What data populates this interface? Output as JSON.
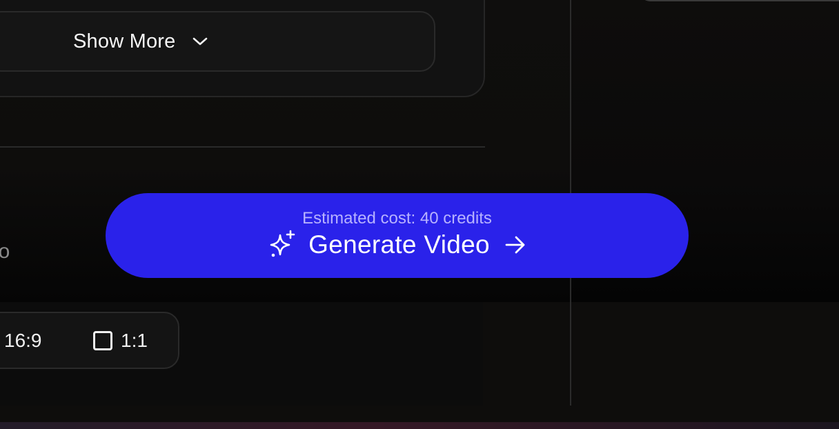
{
  "settings": {
    "show_more_label": "Show More",
    "aspect_ratio_label": "atio",
    "aspect_options": [
      {
        "label": "16:9"
      },
      {
        "label": "1:1"
      }
    ]
  },
  "generate": {
    "cost_text": "Estimated cost: 40 credits",
    "label": "Generate Video"
  },
  "icons": {
    "show_more": "chevron-down-icon",
    "generate_leading": "sparkles-icon",
    "generate_trailing": "arrow-right-icon",
    "square_ratio": "square-icon"
  },
  "colors": {
    "accent": "#2a22ea",
    "cost_text": "#b7b2ff",
    "background": "#0e0d0c"
  }
}
